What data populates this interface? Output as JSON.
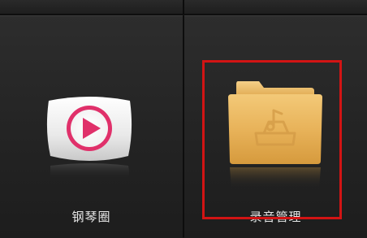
{
  "apps": [
    {
      "label": "钢琴圈",
      "icon": "play-icon",
      "selected": false
    },
    {
      "label": "录音管理",
      "icon": "folder-music-icon",
      "selected": true
    }
  ],
  "colors": {
    "selection": "#d21414",
    "play_accent": "#e0306a",
    "folder": "#e8b35a"
  }
}
